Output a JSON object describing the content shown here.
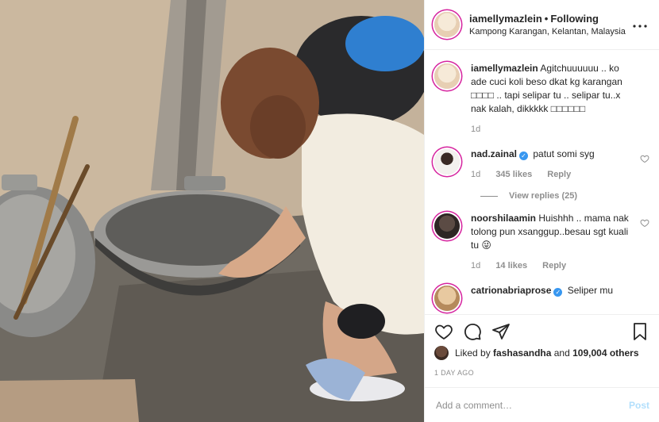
{
  "post": {
    "username": "iamellymazlein",
    "follow_status": "Following",
    "separator": "•",
    "location": "Kampong Karangan, Kelantan, Malaysia"
  },
  "caption": {
    "username": "iamellymazlein",
    "text": "Agitchuuuuuu .. ko ade cuci koli beso dkat kg karangan □□□□ .. tapi selipar tu .. selipar tu..x nak kalah, dikkkkk □□□□□□",
    "time": "1d"
  },
  "comments": [
    {
      "username": "nad.zainal",
      "verified": true,
      "text": "patut somi syg",
      "time": "1d",
      "likes": "345 likes",
      "reply": "Reply"
    },
    {
      "username": "noorshilaamin",
      "verified": false,
      "text": "Huishhh .. mama nak tolong pun xsanggup..besau sgt kuali tu 😜",
      "time": "1d",
      "likes": "14 likes",
      "reply": "Reply"
    },
    {
      "username": "catrionabriaprose",
      "verified": true,
      "text": "Seliper mu"
    }
  ],
  "view_replies": "View replies (25)",
  "likes_summary": {
    "prefix": "Liked by",
    "liker": "fashasandha",
    "connector": "and",
    "count": "109,004 others"
  },
  "time_ago": "1 DAY AGO",
  "add_comment": {
    "placeholder": "Add a comment…",
    "post_label": "Post"
  },
  "icons": {
    "more": "more-options-icon",
    "like": "heart-icon",
    "comment": "comment-icon",
    "share": "share-icon",
    "save": "bookmark-icon"
  },
  "colors": {
    "brand_ring": "#d6249f",
    "verified": "#3897f0",
    "post_disabled": "#b2dffc"
  }
}
